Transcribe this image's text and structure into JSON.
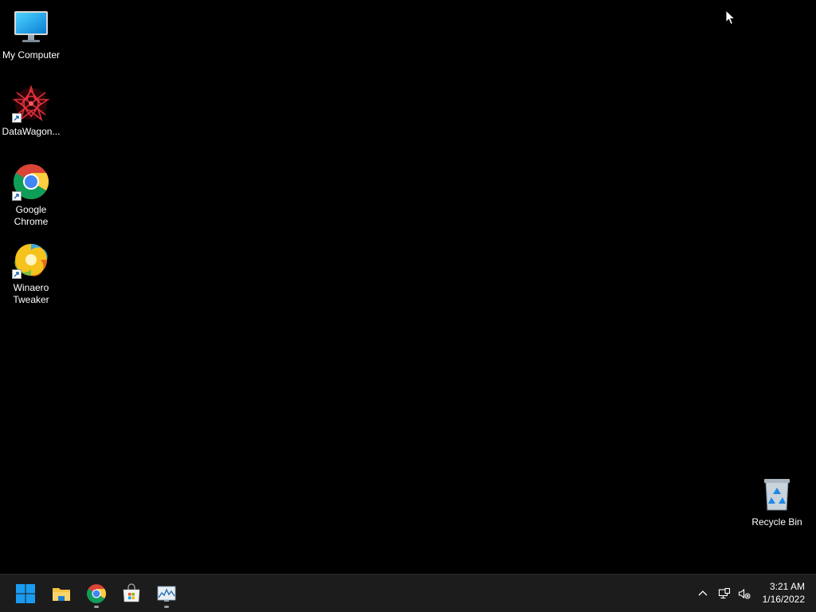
{
  "desktop": {
    "icons": [
      {
        "label": "My Computer",
        "icon": "monitor-icon",
        "shortcut": false
      },
      {
        "label": "DataWagon...",
        "icon": "datawagon-icon",
        "shortcut": true
      },
      {
        "label": "Google Chrome",
        "icon": "chrome-icon",
        "shortcut": true
      },
      {
        "label": "Winaero Tweaker",
        "icon": "winaero-icon",
        "shortcut": true
      }
    ],
    "recycle_bin": {
      "label": "Recycle Bin",
      "icon": "recycle-bin-icon"
    }
  },
  "taskbar": {
    "pinned": [
      {
        "name": "Start",
        "icon": "windows-start-icon"
      },
      {
        "name": "File Explorer",
        "icon": "folder-icon"
      },
      {
        "name": "Google Chrome",
        "icon": "chrome-icon"
      },
      {
        "name": "Microsoft Store",
        "icon": "store-icon"
      },
      {
        "name": "Performance Monitor",
        "icon": "perfmon-icon"
      }
    ],
    "tray": {
      "icons": [
        "chevron-up-icon",
        "network-icon",
        "volume-muted-icon"
      ],
      "time": "3:21 AM",
      "date": "1/16/2022"
    }
  },
  "colors": {
    "desktop_bg": "#000000",
    "taskbar_bg": "#1c1c1c",
    "windows_blue": "#1a9bf0"
  }
}
